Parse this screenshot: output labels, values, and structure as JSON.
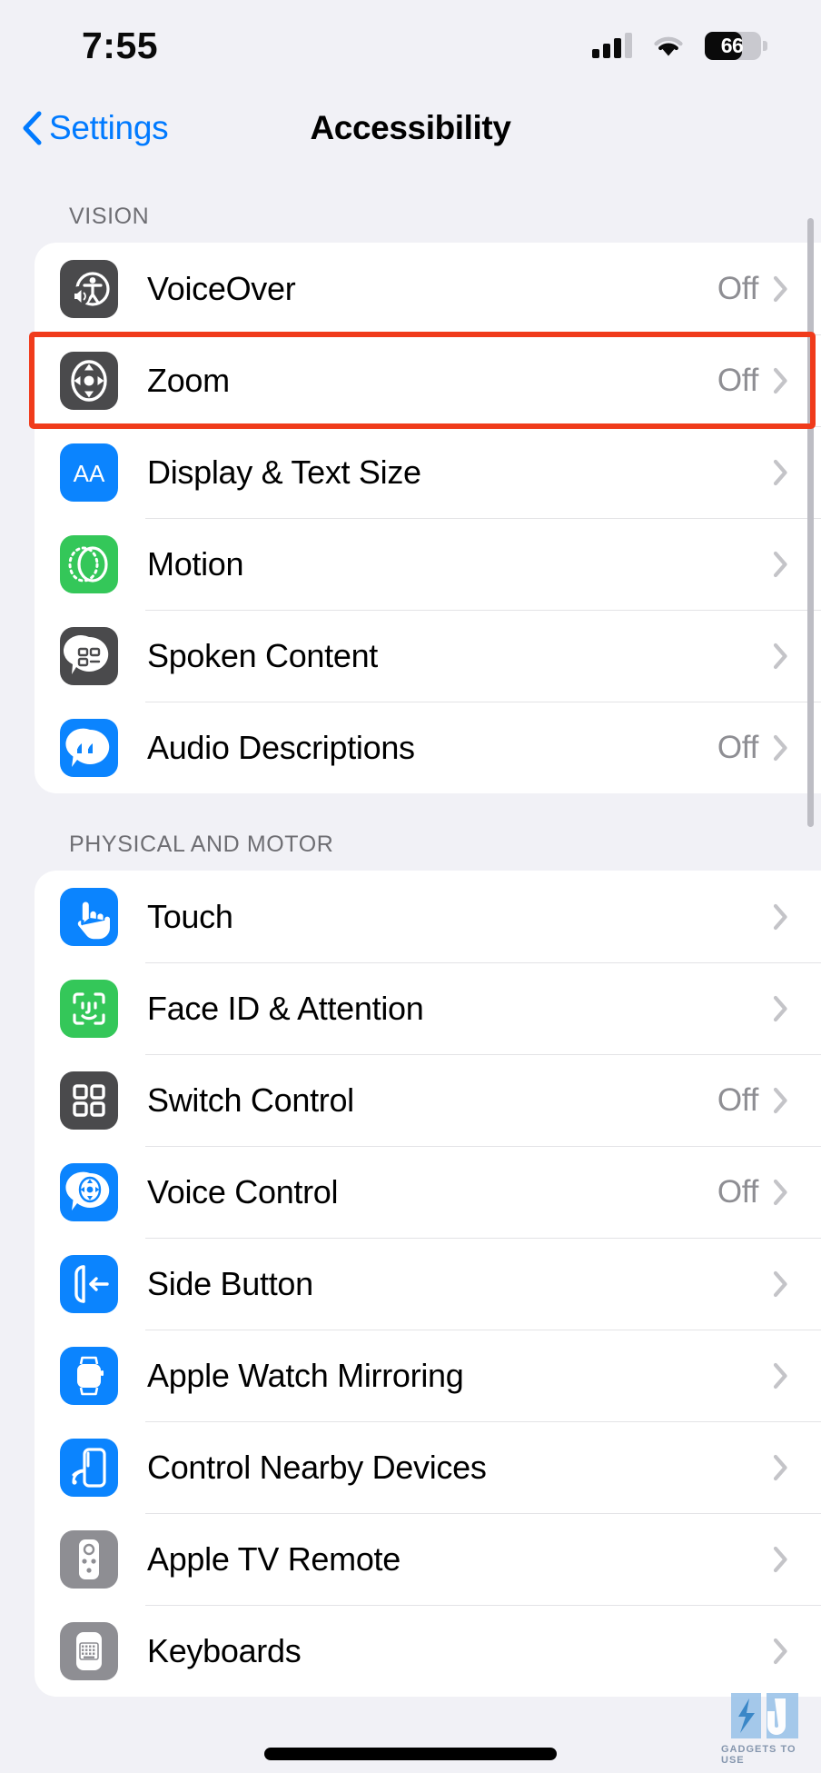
{
  "status_bar": {
    "time": "7:55",
    "cellular_bars_filled": 3,
    "cellular_bars_total": 4,
    "wifi": "wifi-icon",
    "battery_percent": "66",
    "battery_level": 66
  },
  "nav": {
    "back_label": "Settings",
    "title": "Accessibility"
  },
  "colors": {
    "accent_blue": "#007aff",
    "icon_blue": "#0b84fe",
    "icon_green": "#34c759",
    "icon_gray_dark": "#4a4a4c",
    "icon_gray_light": "#8e8e93",
    "highlight_red": "#f03b1b",
    "value_gray": "#8e8e93",
    "page_bg": "#f1f1f6"
  },
  "sections": [
    {
      "header": "VISION",
      "rows": [
        {
          "label": "VoiceOver",
          "value": "Off",
          "icon": "voiceover-icon",
          "icon_style": "gray-dark"
        },
        {
          "label": "Zoom",
          "value": "Off",
          "icon": "zoom-icon",
          "icon_style": "gray-dark",
          "highlighted": true
        },
        {
          "label": "Display & Text Size",
          "value": "",
          "icon": "display-text-size-icon",
          "icon_style": "blue"
        },
        {
          "label": "Motion",
          "value": "",
          "icon": "motion-icon",
          "icon_style": "green"
        },
        {
          "label": "Spoken Content",
          "value": "",
          "icon": "spoken-content-icon",
          "icon_style": "gray-dark"
        },
        {
          "label": "Audio Descriptions",
          "value": "Off",
          "icon": "audio-descriptions-icon",
          "icon_style": "blue"
        }
      ]
    },
    {
      "header": "PHYSICAL AND MOTOR",
      "rows": [
        {
          "label": "Touch",
          "value": "",
          "icon": "touch-hand-icon",
          "icon_style": "blue"
        },
        {
          "label": "Face ID & Attention",
          "value": "",
          "icon": "face-id-icon",
          "icon_style": "green"
        },
        {
          "label": "Switch Control",
          "value": "Off",
          "icon": "switch-control-grid-icon",
          "icon_style": "gray-dark"
        },
        {
          "label": "Voice Control",
          "value": "Off",
          "icon": "voice-control-icon",
          "icon_style": "blue"
        },
        {
          "label": "Side Button",
          "value": "",
          "icon": "side-button-icon",
          "icon_style": "blue"
        },
        {
          "label": "Apple Watch Mirroring",
          "value": "",
          "icon": "apple-watch-icon",
          "icon_style": "blue"
        },
        {
          "label": "Control Nearby Devices",
          "value": "",
          "icon": "control-nearby-devices-icon",
          "icon_style": "blue"
        },
        {
          "label": "Apple TV Remote",
          "value": "",
          "icon": "apple-tv-remote-icon",
          "icon_style": "gray-light"
        },
        {
          "label": "Keyboards",
          "value": "",
          "icon": "keyboard-icon",
          "icon_style": "gray-light"
        }
      ]
    }
  ],
  "watermark": {
    "text": "GADGETS TO USE"
  }
}
